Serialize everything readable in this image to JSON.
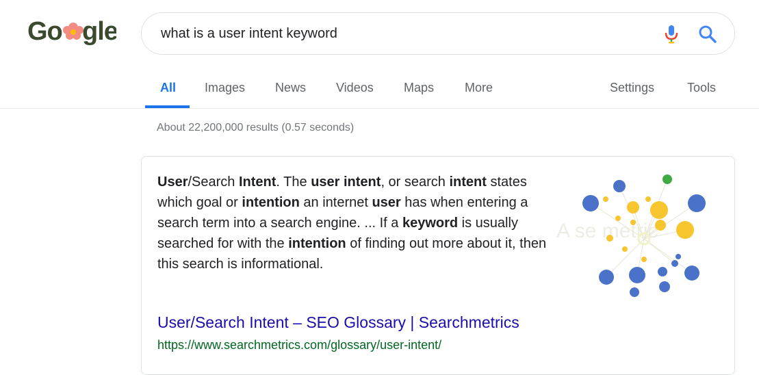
{
  "logo": {
    "text": "Google"
  },
  "search": {
    "query": "what is a user intent keyword",
    "mic_icon": "mic-icon",
    "search_icon": "search-icon"
  },
  "tabs": [
    {
      "label": "All",
      "active": true
    },
    {
      "label": "Images"
    },
    {
      "label": "News"
    },
    {
      "label": "Videos"
    },
    {
      "label": "Maps"
    },
    {
      "label": "More"
    }
  ],
  "tools": {
    "settings": "Settings",
    "tools": "Tools"
  },
  "results_stats": "About 22,200,000 results (0.57 seconds)",
  "featured_snippet": {
    "segments": [
      {
        "t": "User",
        "b": true
      },
      {
        "t": "/Search ",
        "b": false
      },
      {
        "t": "Intent",
        "b": true
      },
      {
        "t": ". The ",
        "b": false
      },
      {
        "t": "user intent",
        "b": true
      },
      {
        "t": ", or search ",
        "b": false
      },
      {
        "t": "intent",
        "b": true
      },
      {
        "t": " states which goal or ",
        "b": false
      },
      {
        "t": "intention",
        "b": true
      },
      {
        "t": " an internet ",
        "b": false
      },
      {
        "t": "user",
        "b": true
      },
      {
        "t": " has when entering a search term into a search engine. ... If a ",
        "b": false
      },
      {
        "t": "keyword",
        "b": true
      },
      {
        "t": " is usually searched for with the ",
        "b": false
      },
      {
        "t": "intention",
        "b": true
      },
      {
        "t": " of finding out more about it, then this search is informational.",
        "b": false
      }
    ],
    "title": "User/Search Intent – SEO Glossary | Searchmetrics",
    "url": "https://www.searchmetrics.com/glossary/user-intent/"
  },
  "colors": {
    "accent": "#1a73e8",
    "link": "#1a0dab",
    "url": "#006621"
  }
}
